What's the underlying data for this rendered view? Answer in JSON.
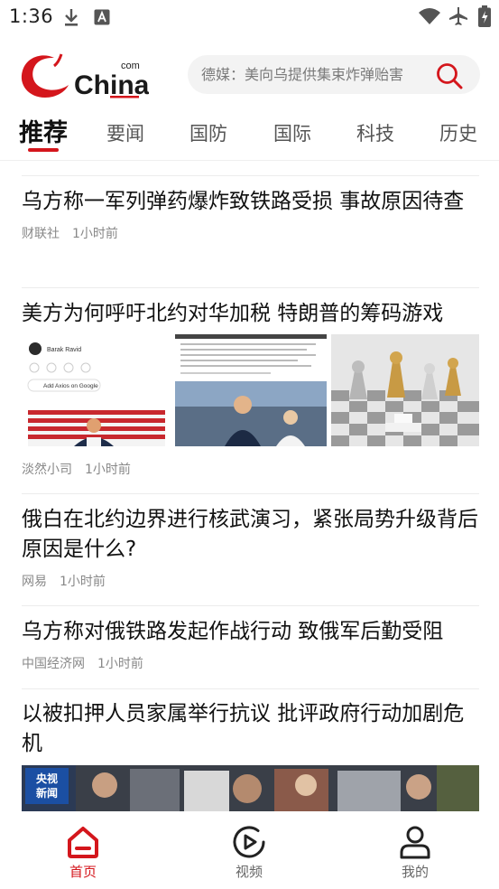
{
  "status_bar": {
    "time": "1:36"
  },
  "header": {
    "logo_text": "China",
    "logo_com": "com",
    "search_placeholder": "德媒：美向乌提供集束炸弹贻害"
  },
  "tabs": [
    {
      "label": "推荐"
    },
    {
      "label": "要闻"
    },
    {
      "label": "国防"
    },
    {
      "label": "国际"
    },
    {
      "label": "科技"
    },
    {
      "label": "历史"
    }
  ],
  "articles": [
    {
      "title": "乌方称一军列弹药爆炸致铁路受损 事故原因待查",
      "source": "财联社",
      "time": "1小时前"
    },
    {
      "title": "美方为何呼吁北约对华加税 特朗普的筹码游戏",
      "source": "淡然小司",
      "time": "1小时前",
      "thumb1": {
        "name": "Barak Ravid",
        "link": "Add Axios on Google"
      }
    },
    {
      "title": "俄白在北约边界进行核武演习，紧张局势升级背后原因是什么?",
      "source": "网易",
      "time": "1小时前"
    },
    {
      "title": "乌方称对俄铁路发起作战行动 致俄军后勤受阻",
      "source": "中国经济网",
      "time": "1小时前"
    },
    {
      "title": "以被扣押人员家属举行抗议 批评政府行动加剧危机",
      "badge": [
        "央视",
        "新闻"
      ]
    }
  ],
  "bottom_nav": [
    {
      "label": "首页",
      "icon": "home-icon"
    },
    {
      "label": "视频",
      "icon": "video-play-icon"
    },
    {
      "label": "我的",
      "icon": "profile-icon"
    }
  ],
  "colors": {
    "accent": "#d4161c"
  }
}
